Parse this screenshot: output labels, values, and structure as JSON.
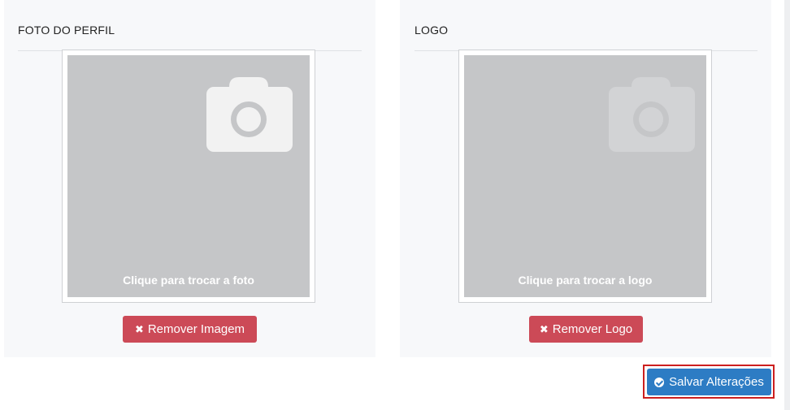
{
  "profile_photo": {
    "title": "FOTO DO PERFIL",
    "image_caption": "Clique para trocar a foto",
    "remove_button_label": "Remover Imagem",
    "remove_icon": "times-icon",
    "placeholder_icon": "camera-icon"
  },
  "logo": {
    "title": "LOGO",
    "image_caption": "Clique para trocar a logo",
    "remove_button_label": "Remover Logo",
    "remove_icon": "times-icon",
    "placeholder_icon": "camera-icon"
  },
  "actions": {
    "save_button_label": "Salvar Alterações",
    "save_icon": "check-circle-icon"
  },
  "colors": {
    "panel_background": "#f7f8fa",
    "image_placeholder": "#c5c6c8",
    "danger": "#cc4a57",
    "primary": "#2d7cc4",
    "highlight_border": "#cc1f1f"
  }
}
